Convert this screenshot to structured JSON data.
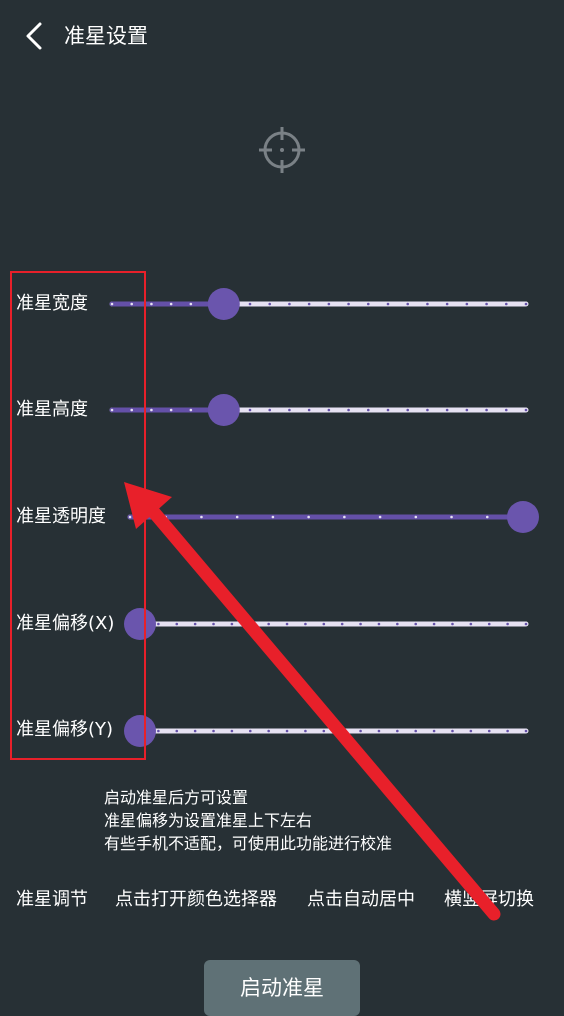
{
  "header": {
    "title": "准星设置",
    "back_icon": "chevron-left-icon"
  },
  "preview": {
    "icon": "crosshair-icon"
  },
  "sliders": [
    {
      "label": "准星宽度",
      "value": 0.27
    },
    {
      "label": "准星高度",
      "value": 0.27
    },
    {
      "label": "准星透明度",
      "value": 1.0
    },
    {
      "label": "准星偏移(X)",
      "value": 0.0
    },
    {
      "label": "准星偏移(Y)",
      "value": 0.0
    }
  ],
  "notes": {
    "line1": "启动准星后方可设置",
    "line2": "准星偏移为设置准星上下左右",
    "line3": "有些手机不适配，可使用此功能进行校准"
  },
  "actions": {
    "adjust": "准星调节",
    "color_picker": "点击打开颜色选择器",
    "auto_center": "点击自动居中",
    "orientation": "横竖屏切换"
  },
  "start_button": "启动准星",
  "colors": {
    "background": "#273035",
    "slider_fill": "#6450a8",
    "slider_track": "#e6e1f2",
    "thumb": "#6a55ad",
    "annotation": "#e8202a",
    "button": "#5f7176"
  }
}
